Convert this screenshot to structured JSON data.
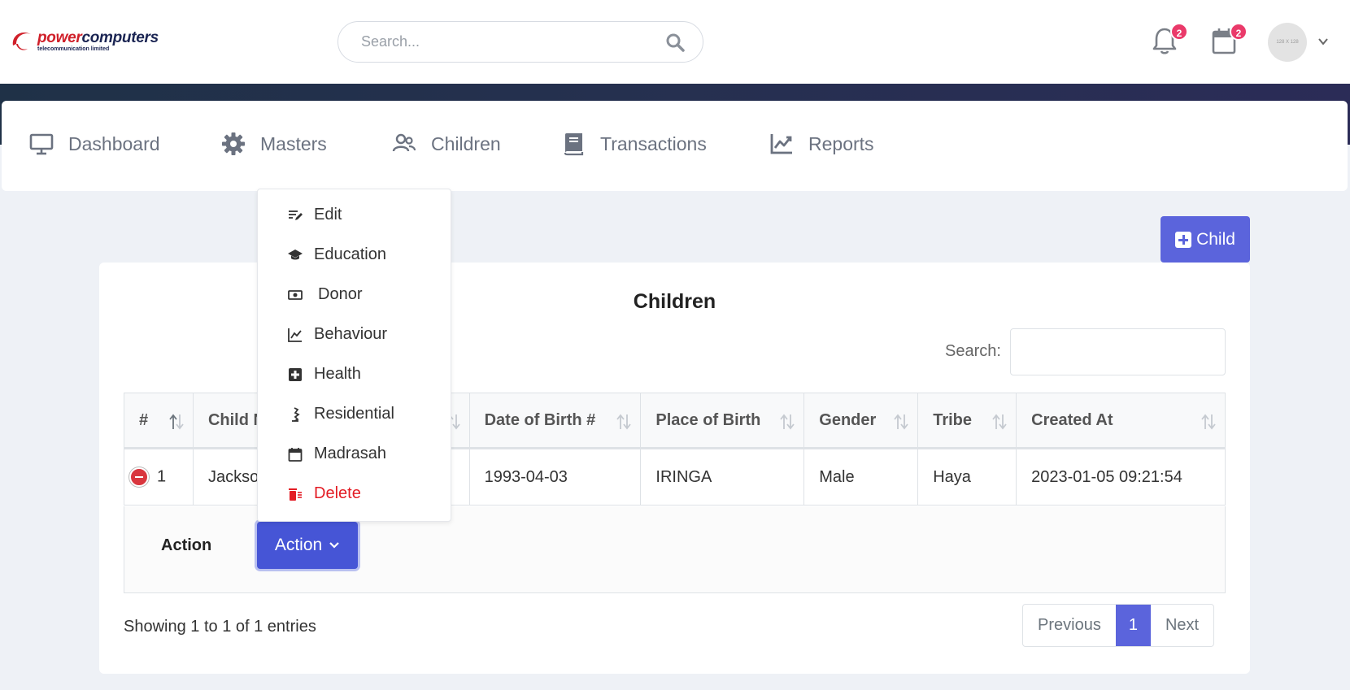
{
  "header": {
    "logo": {
      "brand_part1": "power",
      "brand_part2": "computers",
      "tagline": "telecommunication limited"
    },
    "search": {
      "placeholder": "Search..."
    },
    "notifications": {
      "count": "2"
    },
    "calendar": {
      "count": "2"
    },
    "avatar": {
      "label": "128 X 128"
    }
  },
  "nav": {
    "items": [
      {
        "label": "Dashboard",
        "icon": "monitor-icon"
      },
      {
        "label": "Masters",
        "icon": "gear-icon"
      },
      {
        "label": "Children",
        "icon": "users-icon"
      },
      {
        "label": "Transactions",
        "icon": "book-icon"
      },
      {
        "label": "Reports",
        "icon": "chart-line-icon"
      }
    ]
  },
  "add_child_button": {
    "label": "Child"
  },
  "card": {
    "title": "Children",
    "search_label": "Search:",
    "columns": [
      "#",
      "Child N",
      "Date of Birth #",
      "Place of Birth",
      "Gender",
      "Tribe",
      "Created At"
    ],
    "rows": [
      {
        "index": "1",
        "child_name": "Jackso",
        "dob": "1993-04-03",
        "place": "IRINGA",
        "gender": "Male",
        "tribe": "Haya",
        "created_at": "2023-01-05 09:21:54"
      }
    ],
    "child_row": {
      "label": "Action",
      "button": "Action"
    },
    "info": "Showing 1 to 1 of 1 entries",
    "pagination": {
      "previous": "Previous",
      "current": "1",
      "next": "Next"
    }
  },
  "dropdown": {
    "items": [
      {
        "label": "Edit",
        "icon": "edit-icon"
      },
      {
        "label": "Education",
        "icon": "graduation-cap-icon"
      },
      {
        "label": "Donor",
        "icon": "money-icon"
      },
      {
        "label": "Behaviour",
        "icon": "chart-line-icon"
      },
      {
        "label": "Health",
        "icon": "medical-plus-icon"
      },
      {
        "label": "Residential",
        "icon": "building-icon"
      },
      {
        "label": "Madrasah",
        "icon": "calendar-icon"
      },
      {
        "label": "Delete",
        "icon": "trash-icon"
      }
    ],
    "delete_color": "#e31c24"
  },
  "colors": {
    "primary": "#5b64dc",
    "action_button": "#4655d6",
    "badge": "#ea3a6a",
    "logo_red": "#d0202a",
    "logo_navy": "#1b2553"
  }
}
